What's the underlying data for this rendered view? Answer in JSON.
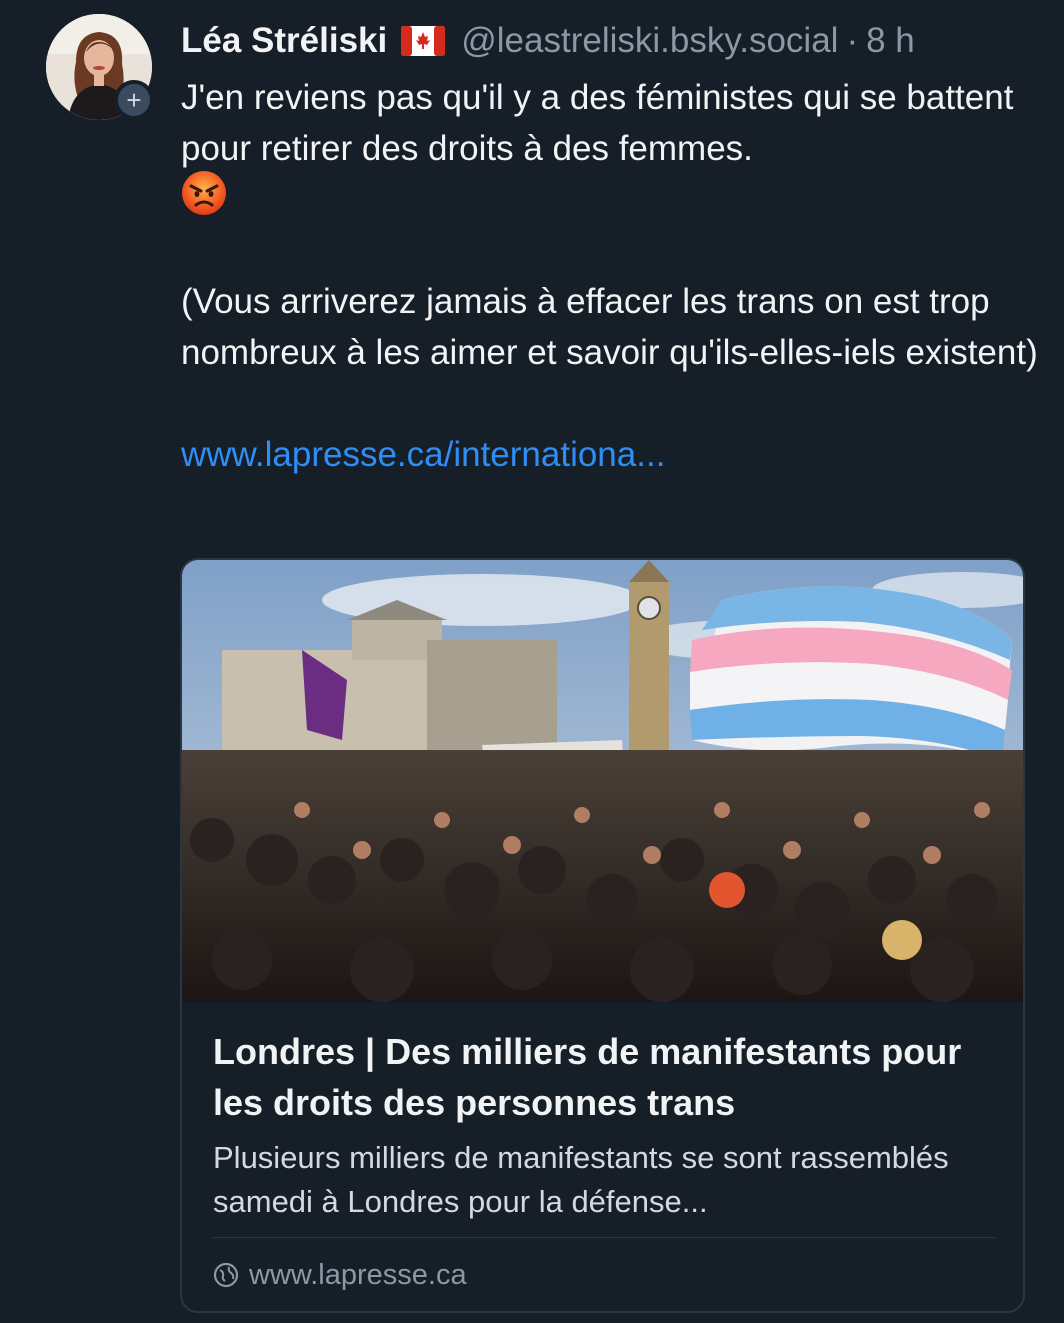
{
  "post": {
    "author_name": "Léa Stréliski",
    "author_flag": "🇨🇦",
    "handle": "@leastreliski.bsky.social",
    "separator": "·",
    "time": "8 h",
    "text_line1": "J'en reviens pas qu'il y a des féministes qui se battent pour retirer des droits à des femmes.",
    "emoji": "😡",
    "text_line2": "(Vous arriverez jamais à effacer les trans on est trop nombreux à les aimer et savoir qu'ils-elles-iels existent)",
    "link_text": "www.lapresse.ca/internationa...",
    "follow_label": "+"
  },
  "card": {
    "title": "Londres | Des milliers de manifestants pour les droits des personnes trans",
    "description": "Plusieurs milliers de manifestants se sont rassemblés samedi à Londres pour la défense...",
    "domain": "www.lapresse.ca"
  },
  "icons": {
    "follow": "plus-icon",
    "domain": "globe-icon",
    "flag": "canada-flag-icon",
    "emoji": "angry-face-icon"
  },
  "colors": {
    "background": "#161e27",
    "link": "#2f8ef6",
    "muted": "#8d98a6",
    "text": "#f1f3f5",
    "card_border": "#2b3645"
  }
}
